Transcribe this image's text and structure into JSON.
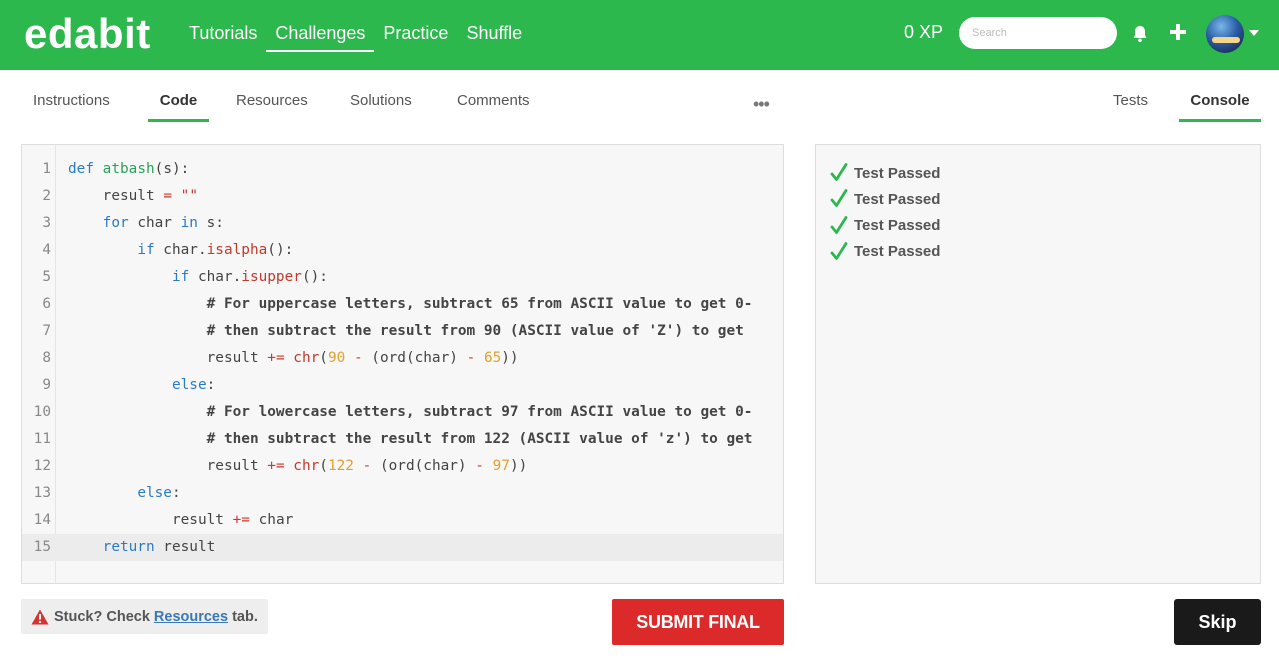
{
  "header": {
    "logo": "edabit",
    "nav": [
      "Tutorials",
      "Challenges",
      "Practice",
      "Shuffle"
    ],
    "active_nav": "Challenges",
    "xp": "0 XP",
    "search_placeholder": "Search",
    "icons": [
      "bell-icon",
      "plus-icon",
      "avatar",
      "chevron-down-icon"
    ],
    "brand_color": "#2db84d"
  },
  "left_tabs": [
    "Instructions",
    "Code",
    "Resources",
    "Solutions",
    "Comments"
  ],
  "active_left_tab": "Code",
  "more_label": "•••",
  "right_tabs": [
    "Tests",
    "Console"
  ],
  "active_right_tab": "Console",
  "editor": {
    "line_numbers": [
      "1",
      "2",
      "3",
      "4",
      "5",
      "6",
      "7",
      "8",
      "9",
      "10",
      "11",
      "12",
      "13",
      "14",
      "15"
    ],
    "current_line": 15,
    "lines": [
      "def atbash(s):",
      "    result = \"\"",
      "    for char in s:",
      "        if char.isalpha():",
      "            if char.isupper():",
      "                # For uppercase letters, subtract 65 from ASCII value to get 0-",
      "                # then subtract the result from 90 (ASCII value of 'Z') to get",
      "                result += chr(90 - (ord(char) - 65))",
      "            else:",
      "                # For lowercase letters, subtract 97 from ASCII value to get 0-",
      "                # then subtract the result from 122 (ASCII value of 'z') to get",
      "                result += chr(122 - (ord(char) - 97))",
      "        else:",
      "            result += char",
      "    return result"
    ]
  },
  "console": {
    "results": [
      "Test Passed",
      "Test Passed",
      "Test Passed",
      "Test Passed"
    ],
    "pass_color": "#2db84d"
  },
  "footer": {
    "stuck_prefix": "Stuck? Check",
    "stuck_link": "Resources",
    "stuck_suffix": "tab.",
    "submit_label": "SUBMIT FINAL",
    "skip_label": "Skip",
    "submit_color": "#dc2a2a"
  }
}
